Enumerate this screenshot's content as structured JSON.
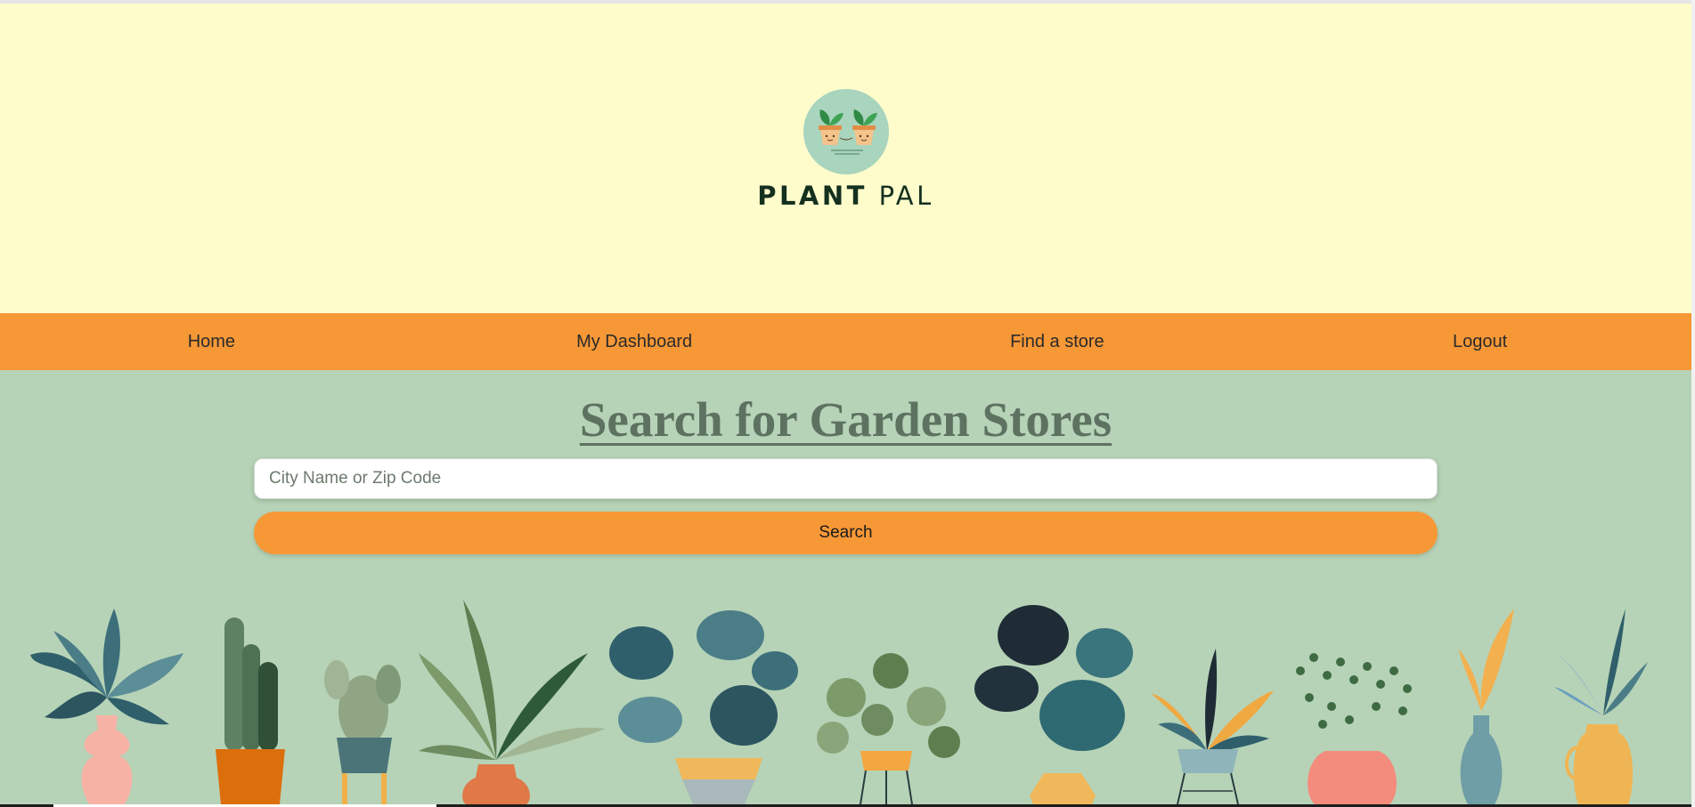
{
  "brand": {
    "name_bold": "PLANT",
    "name_light": "PAL"
  },
  "nav": {
    "items": [
      {
        "label": "Home"
      },
      {
        "label": "My Dashboard"
      },
      {
        "label": "Find a store"
      },
      {
        "label": "Logout"
      }
    ]
  },
  "search": {
    "title": "Search for Garden Stores",
    "placeholder": "City Name or Zip Code",
    "value": "",
    "button_label": "Search"
  },
  "decor": {
    "illustration": "potted-plants-row-illustration"
  },
  "colors": {
    "header_bg": "#fffccc",
    "nav_bg": "#f79837",
    "main_bg": "#b6d3b7",
    "title": "#5e7261",
    "brand_dark": "#14301f"
  }
}
